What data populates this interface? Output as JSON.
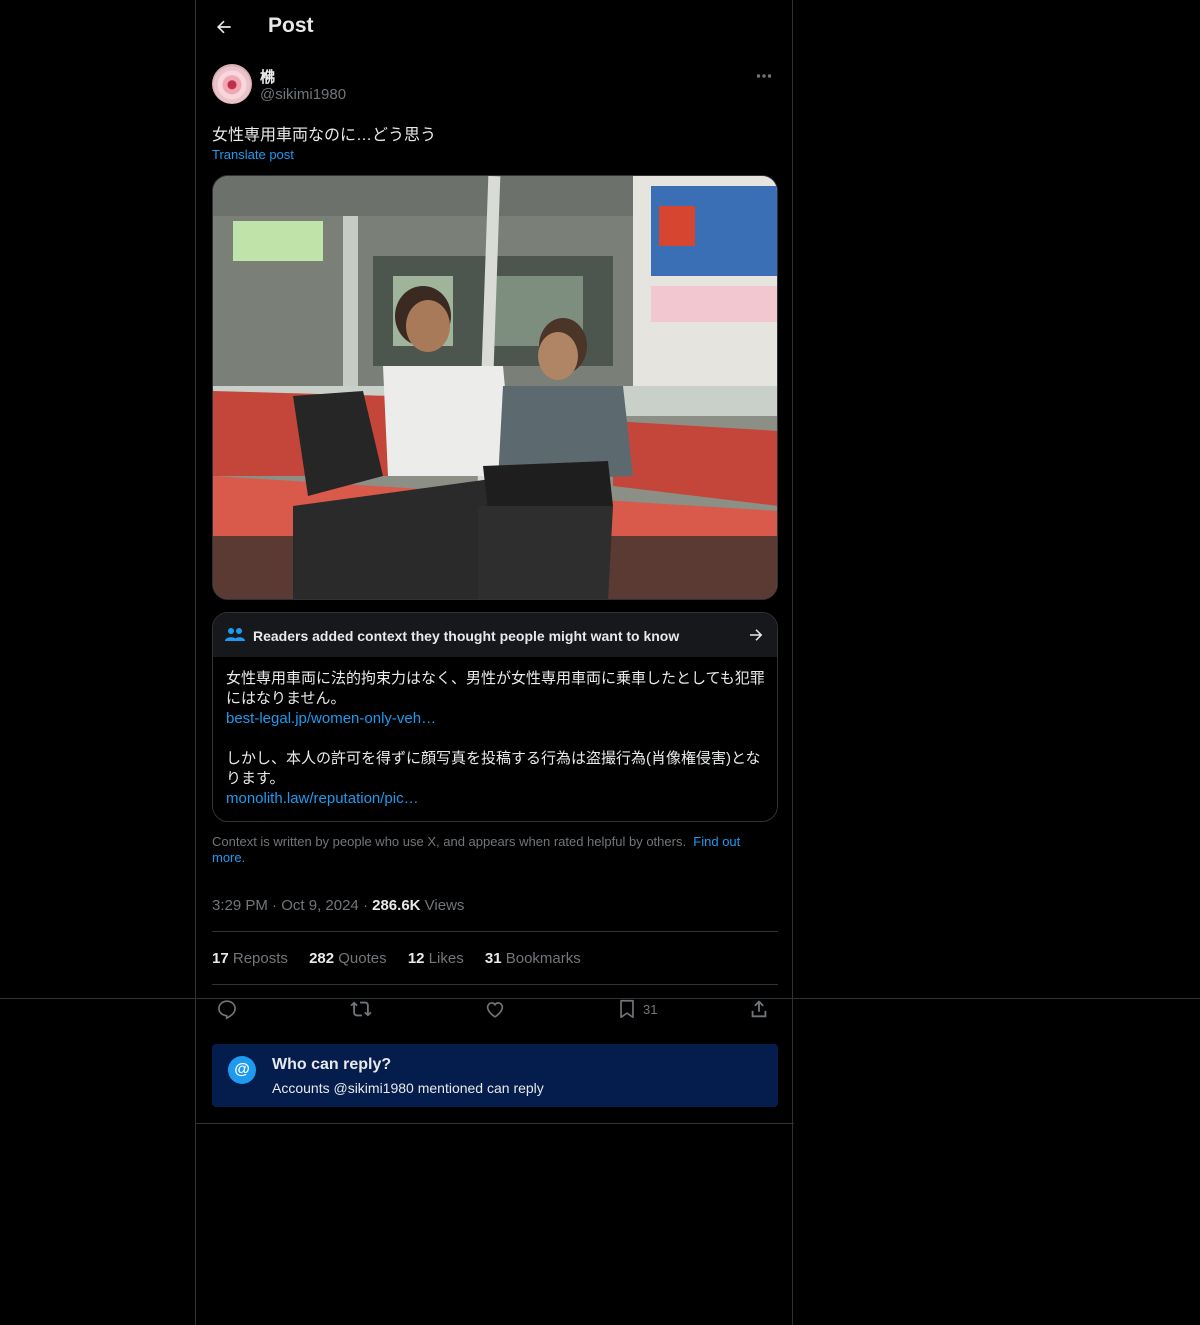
{
  "header": {
    "title": "Post"
  },
  "author": {
    "name": "梻",
    "handle": "@sikimi1980"
  },
  "post": {
    "text": "女性専用車両なのに…どう思う",
    "translate_label": "Translate post"
  },
  "community_note": {
    "title": "Readers added context they thought people might want to know",
    "paragraph1": "女性専用車両に法的拘束力はなく、男性が女性専用車両に乗車したとしても犯罪にはなりません。",
    "link1": "best-legal.jp/women-only-veh…",
    "paragraph2": "しかし、本人の許可を得ずに顔写真を投稿する行為は盗撮行為(肖像権侵害)となります。",
    "link2": "monolith.law/reputation/pic…"
  },
  "context_footer": {
    "text": "Context is written by people who use X, and appears when rated helpful by others.",
    "link": "Find out more."
  },
  "meta": {
    "time": "3:29 PM",
    "date": "Oct 9, 2024",
    "views_count": "286.6K",
    "views_label": "Views"
  },
  "stats": {
    "reposts_count": "17",
    "reposts_label": "Reposts",
    "quotes_count": "282",
    "quotes_label": "Quotes",
    "likes_count": "12",
    "likes_label": "Likes",
    "bookmarks_count": "31",
    "bookmarks_label": "Bookmarks"
  },
  "actions": {
    "bookmark_count": "31",
    "icons": [
      "reply-icon",
      "repost-icon",
      "like-icon",
      "bookmark-icon",
      "share-icon"
    ]
  },
  "reply_restriction": {
    "title": "Who can reply?",
    "subtitle": "Accounts @sikimi1980 mentioned can reply",
    "icon_glyph": "@"
  },
  "colors": {
    "accent": "#1d9bf0",
    "background": "#000000",
    "muted": "#71767b",
    "reply_box": "#051d4d"
  }
}
